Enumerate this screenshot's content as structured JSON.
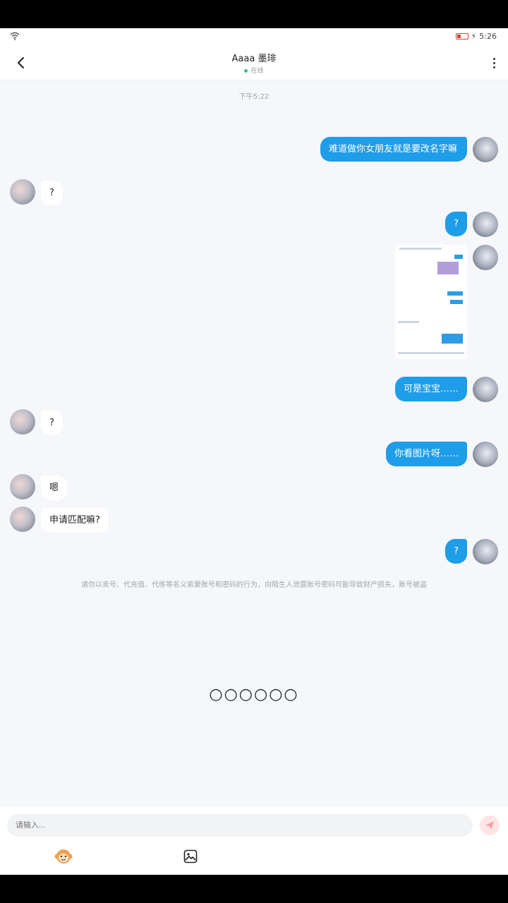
{
  "status": {
    "time": "5:26",
    "battery": "低"
  },
  "header": {
    "title": "Aaaa 墨琲",
    "online": "在线"
  },
  "chat": {
    "timestamp": "下午5:22",
    "messages": [
      {
        "side": "out",
        "text": "难道做你女朋友就是要改名字嘛"
      },
      {
        "side": "in",
        "text": "?"
      },
      {
        "side": "out",
        "text": "?"
      },
      {
        "side": "out",
        "type": "image",
        "text": ""
      },
      {
        "side": "out",
        "text": "可是宝宝……"
      },
      {
        "side": "in",
        "text": "?"
      },
      {
        "side": "out",
        "text": "你看图片呀……"
      },
      {
        "side": "in",
        "text": "嗯"
      },
      {
        "side": "in",
        "text": "申请匹配嘛?"
      },
      {
        "side": "out",
        "text": "?"
      }
    ],
    "warning": "请勿以卖号、代充值、代练等名义索要账号和密码的行为，向陌生人泄露账号密码可能导致财产损失，账号被盗",
    "loader": "○○○○○○"
  },
  "input": {
    "placeholder": "请输入..."
  },
  "icons": {
    "back": "chevron-left-icon",
    "more": "more-vertical-icon",
    "send": "send-icon",
    "emoji": "monkey-emoji-icon",
    "image": "image-icon"
  },
  "colors": {
    "outgoing_bubble": "#1e9de8",
    "background": "#f5f7fa"
  }
}
